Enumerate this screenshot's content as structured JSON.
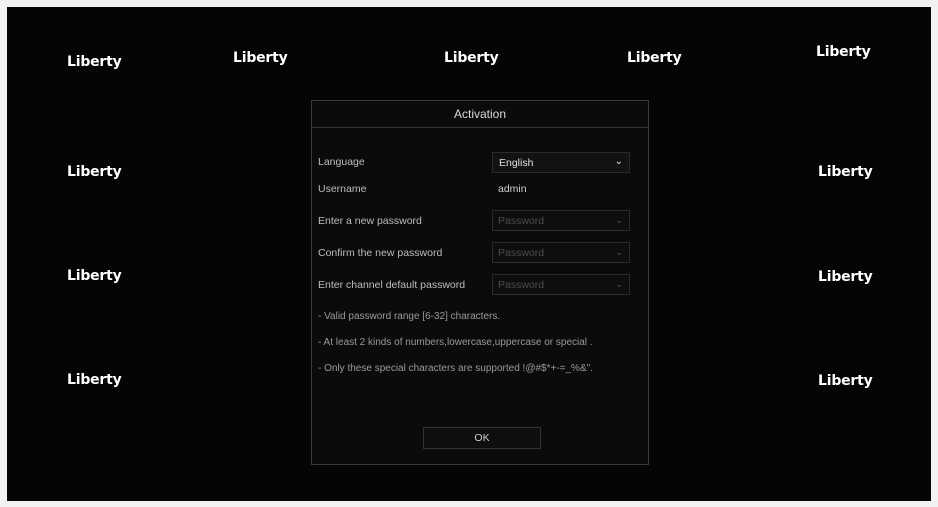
{
  "brand": {
    "logo_text": "Liberty"
  },
  "dialog": {
    "title": "Activation",
    "language_label": "Language",
    "language_value": "English",
    "username_label": "Username",
    "username_value": "admin",
    "new_password_label": "Enter a new password",
    "new_password_placeholder": "Password",
    "confirm_password_label": "Confirm the new password",
    "confirm_password_placeholder": "Password",
    "channel_password_label": "Enter channel default password",
    "channel_password_placeholder": "Password",
    "notes": [
      "- Valid password range [6-32] characters.",
      "- At least 2 kinds of numbers,lowercase,uppercase or special .",
      "- Only these special characters are supported !@#$*+-=_%&\"."
    ],
    "ok_label": "OK"
  },
  "icons": {
    "dropdown": "chevron-down-icon"
  },
  "colors": {
    "background": "#050505",
    "dialog_border": "#3a3a3a",
    "text": "#d8d8d8",
    "placeholder": "#4d4d4d"
  }
}
